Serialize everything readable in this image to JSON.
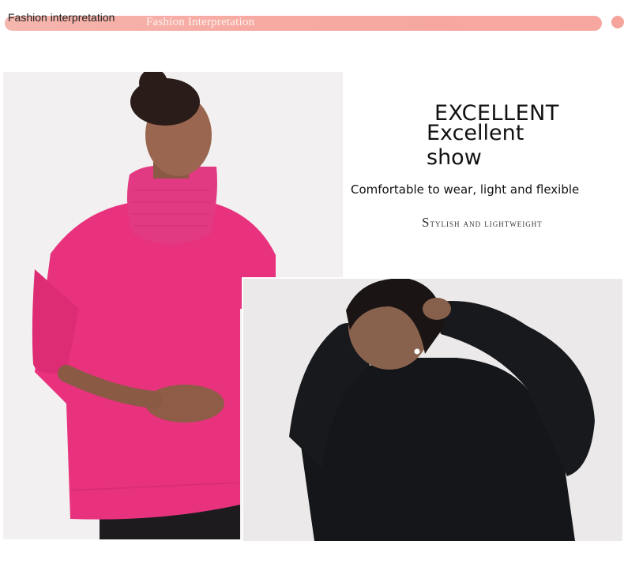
{
  "header": {
    "label": "Fashion interpretation",
    "banner_text": "Fashion Interpretation",
    "accent": "#f5a59b"
  },
  "hero": {
    "title_upper": "EXCELLENT",
    "title_lower": "Excellent show",
    "subtitle": "Comfortable to wear, light and flexible",
    "tagline": "Stylish and lightweight"
  },
  "photos": {
    "left": {
      "subject": "model in pink turtleneck sweater",
      "sweater_color": "#e8327e"
    },
    "right": {
      "subject": "model in black turtleneck sweater",
      "sweater_color": "#141519"
    }
  }
}
